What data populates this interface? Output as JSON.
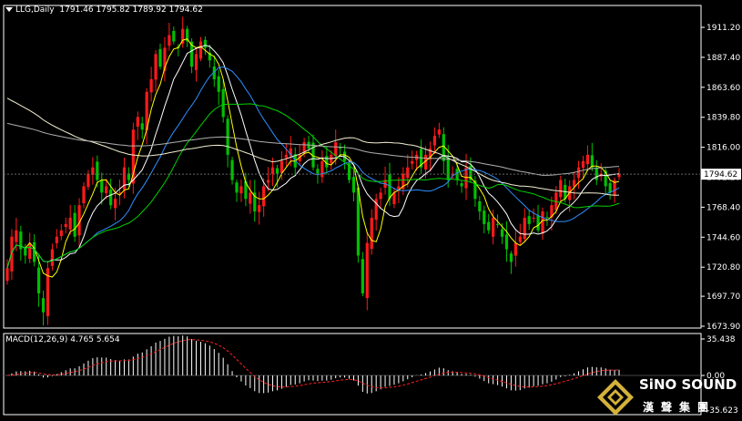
{
  "header": {
    "symbol_timeframe": "LLG,Daily",
    "ohlc": "1791.46 1795.82 1789.92 1794.62"
  },
  "macd_header": "MACD(12,26,9) 4.765 5.654",
  "colors": {
    "background": "#000000",
    "axis": "#ffffff",
    "bull_candle": "#ff1a1a",
    "bear_candle": "#00c000",
    "ma5": "#ffff00",
    "ma10": "#ffffff",
    "ma20": "#2f8fff",
    "ma30": "#00d000",
    "ma60": "#f2eecf",
    "ma120": "#b0b0b0",
    "macd_hist": "#ffffff",
    "macd_signal": "#ff2020"
  },
  "logo": {
    "brand": "SiNO SOUND",
    "chinese": "漢聲集團",
    "icon": "diamond-emblem-icon"
  },
  "chart_data": [
    {
      "type": "candlestick",
      "title": "LLG,Daily",
      "y_ticks": [
        "1911.20",
        "1887.40",
        "1863.60",
        "1839.80",
        "1816.00",
        "1792.20",
        "1768.40",
        "1744.60",
        "1720.80",
        "1697.70",
        "1673.90"
      ],
      "ylim": [
        1673.9,
        1922
      ],
      "current_price": "1794.62",
      "close": [
        1720,
        1745,
        1750,
        1735,
        1730,
        1740,
        1725,
        1700,
        1685,
        1720,
        1735,
        1745,
        1750,
        1755,
        1760,
        1745,
        1770,
        1785,
        1795,
        1800,
        1790,
        1780,
        1785,
        1770,
        1775,
        1780,
        1800,
        1790,
        1830,
        1840,
        1830,
        1860,
        1870,
        1890,
        1880,
        1895,
        1905,
        1900,
        1895,
        1910,
        1900,
        1880,
        1890,
        1900,
        1895,
        1885,
        1870,
        1860,
        1840,
        1810,
        1790,
        1780,
        1785,
        1775,
        1780,
        1765,
        1770,
        1785,
        1790,
        1800,
        1795,
        1805,
        1810,
        1815,
        1800,
        1810,
        1820,
        1815,
        1800,
        1795,
        1805,
        1800,
        1810,
        1820,
        1815,
        1805,
        1790,
        1780,
        1730,
        1700,
        1740,
        1760,
        1775,
        1780,
        1790,
        1775,
        1780,
        1785,
        1795,
        1800,
        1805,
        1810,
        1800,
        1810,
        1815,
        1825,
        1830,
        1805,
        1790,
        1795,
        1790,
        1785,
        1800,
        1790,
        1775,
        1765,
        1755,
        1750,
        1760,
        1755,
        1745,
        1735,
        1725,
        1740,
        1745,
        1760,
        1755,
        1760,
        1750,
        1765,
        1760,
        1770,
        1780,
        1790,
        1775,
        1785,
        1790,
        1800,
        1805,
        1810,
        1800,
        1790,
        1795,
        1785,
        1780,
        1790,
        1794.62
      ],
      "series": [
        {
          "name": "MA5",
          "color": "ma5"
        },
        {
          "name": "MA10",
          "color": "ma10"
        },
        {
          "name": "MA20",
          "color": "ma20"
        },
        {
          "name": "MA30",
          "color": "ma30"
        },
        {
          "name": "MA60",
          "color": "ma60"
        },
        {
          "name": "MA120",
          "color": "ma120"
        }
      ]
    },
    {
      "type": "bar",
      "title": "MACD(12,26,9) 4.765 5.654",
      "y_ticks": [
        "35.438",
        "0.00",
        "-35.623"
      ],
      "ylim": [
        -35.623,
        35.438
      ],
      "series": [
        {
          "name": "MACD",
          "color": "macd_hist"
        },
        {
          "name": "Signal",
          "color": "macd_signal"
        }
      ]
    }
  ]
}
